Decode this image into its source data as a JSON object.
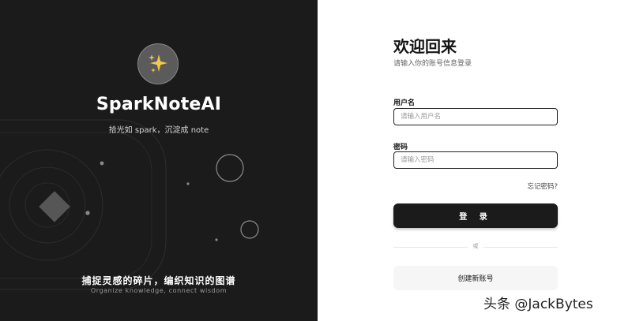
{
  "brand": {
    "name": "SparkNoteAI",
    "tagline": "拾光如 spark，沉淀成 note",
    "logo_icon": "sparkles-icon",
    "bottom_title": "捕捉灵感的碎片，编织知识的图谱",
    "bottom_subtitle": "Organize knowledge, connect wisdom"
  },
  "login": {
    "title": "欢迎回来",
    "subtitle": "请输入你的账号信息登录",
    "username_label": "用户名",
    "username_placeholder": "请输入用户名",
    "username_value": "",
    "password_label": "密码",
    "password_placeholder": "请输入密码",
    "password_value": "",
    "forgot_password": "忘记密码?",
    "login_button": "登 录",
    "divider_text": "或",
    "create_account_button": "创建新账号"
  },
  "watermark": "头条 @JackBytes",
  "colors": {
    "left_panel_bg": "#1b1b1b",
    "primary_button": "#1b1b1b",
    "secondary_button": "#f6f6f6",
    "logo_star": "#f2c94c"
  }
}
